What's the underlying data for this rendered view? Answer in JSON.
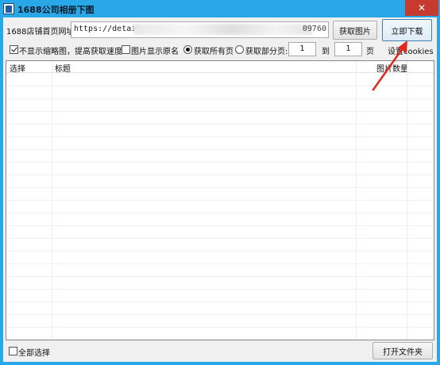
{
  "window": {
    "title": "1688公司相册下图",
    "close_glyph": "✕",
    "icon": "app-icon"
  },
  "toolbar": {
    "url_label": "1688店铺首页网址:",
    "url_value": "https://detail.",
    "url_tail": "09760",
    "fetch_button": "获取图片",
    "download_button": "立即下载"
  },
  "options": {
    "hide_thumbnails": {
      "label": "不显示缩略图，提高获取速度",
      "checked": true
    },
    "show_original_name": {
      "label": "图片显示原名",
      "checked": false
    },
    "fetch_all_pages": {
      "label": "获取所有页",
      "selected": true
    },
    "fetch_partial_pages": {
      "label": "获取部分页:",
      "selected": false
    },
    "page_from": "1",
    "to_label": "到",
    "page_to": "1",
    "page_unit": "页",
    "cookies_link": "设置cookies"
  },
  "table": {
    "columns": [
      "选择",
      "标题",
      "图片数量"
    ],
    "rows": []
  },
  "footer": {
    "select_all": {
      "label": "全部选择",
      "checked": false
    },
    "open_folder_button": "打开文件夹"
  },
  "colors": {
    "titlebar": "#29a8e8",
    "close": "#c73a2f",
    "annotation_arrow": "#e0281e"
  }
}
